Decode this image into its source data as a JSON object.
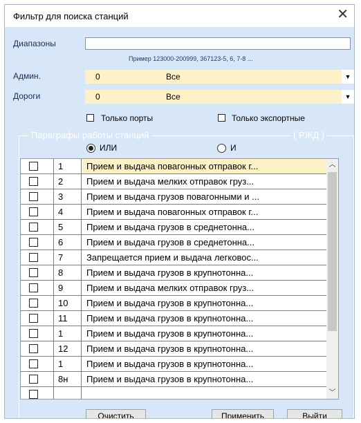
{
  "window": {
    "title": "Фильтр для поиска станций"
  },
  "ranges": {
    "label": "Диапазоны",
    "value": "",
    "hint": "Пример  123000-200999, 367123-5, 6, 7-8 ..."
  },
  "admin": {
    "label": "Админ.",
    "code": "0",
    "value": "Все"
  },
  "roads": {
    "label": "Дороги",
    "code": "0",
    "value": "Все"
  },
  "filters": {
    "ports_only": "Только порты",
    "export_only": "Только экспортные"
  },
  "paragraphs": {
    "title": "Параграфы работы станций",
    "rzd": "( РЖД )",
    "or_label": "ИЛИ",
    "and_label": "И",
    "selected_mode": "ИЛИ",
    "rows": [
      {
        "num": "1",
        "name": "Прием и выдача повагонных отправок г..."
      },
      {
        "num": "2",
        "name": "Прием и выдача мелких отправок груз..."
      },
      {
        "num": "3",
        "name": "Прием и выдача грузов повагонными и ..."
      },
      {
        "num": "4",
        "name": "Прием и выдача повагонных отправок г..."
      },
      {
        "num": "5",
        "name": "Прием и выдача грузов в среднетонна..."
      },
      {
        "num": "6",
        "name": "Прием и выдача грузов в среднетонна..."
      },
      {
        "num": "7",
        "name": "Запрещается прием и выдача легковос..."
      },
      {
        "num": "8",
        "name": "Прием и выдача грузов в крупнотонна..."
      },
      {
        "num": "9",
        "name": "Прием и выдача мелких отправок груз..."
      },
      {
        "num": "10",
        "name": "Прием и выдача грузов в крупнотонна..."
      },
      {
        "num": "11",
        "name": "Прием и выдача грузов в крупнотонна..."
      },
      {
        "num": "1",
        "name": "Прием и выдача грузов в крупнотонна..."
      },
      {
        "num": "12",
        "name": "Прием и выдача грузов в крупнотонна..."
      },
      {
        "num": "1",
        "name": "Прием и выдача грузов в крупнотонна..."
      },
      {
        "num": "8н",
        "name": "Прием и выдача грузов в крупнотонна..."
      },
      {
        "num": "",
        "name": ""
      }
    ]
  },
  "buttons": {
    "clear": "Очистить",
    "apply": "Применить",
    "exit": "Выйти"
  },
  "colors": {
    "window_bg": "#d8e7f7",
    "field_yellow": "#fdf1c8",
    "selected_row": "#fdf1c8"
  }
}
